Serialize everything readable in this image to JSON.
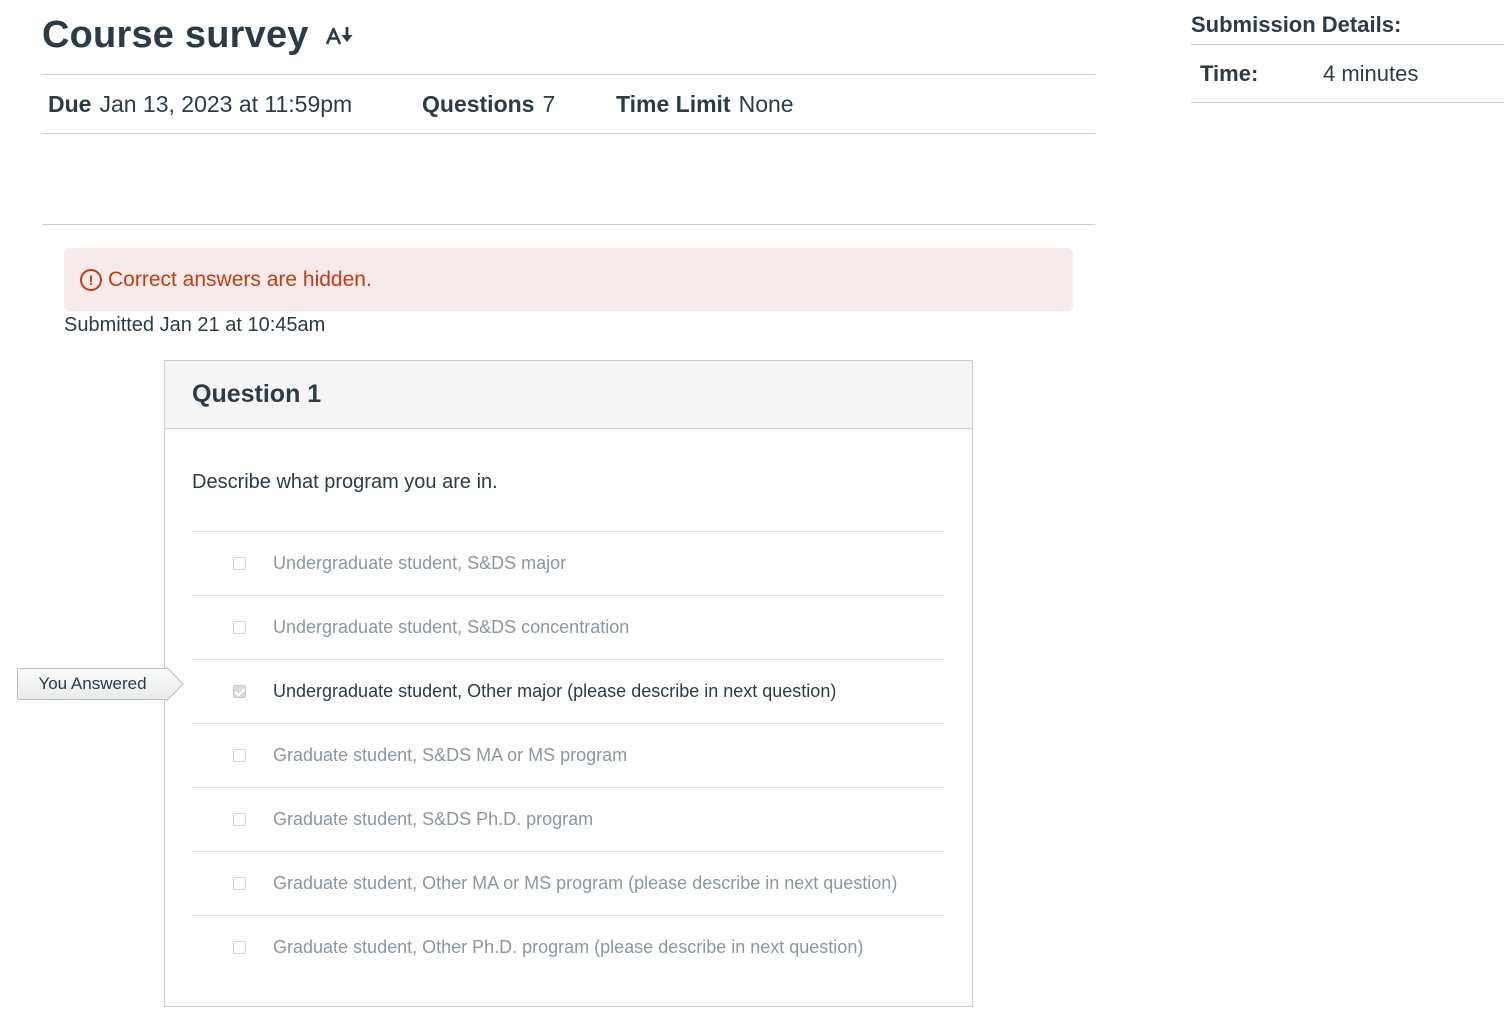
{
  "quiz": {
    "title": "Course survey",
    "title_icon": "sort-down-icon",
    "meta": {
      "due_label": "Due",
      "due_value": "Jan 13, 2023 at 11:59pm",
      "questions_label": "Questions",
      "questions_value": "7",
      "time_limit_label": "Time Limit",
      "time_limit_value": "None"
    }
  },
  "submission_details": {
    "title": "Submission Details:",
    "time_label": "Time:",
    "time_value": "4 minutes"
  },
  "alert": {
    "icon": "exclamation-circle-icon",
    "text": "Correct answers are hidden."
  },
  "submitted_text": "Submitted Jan 21 at 10:45am",
  "question": {
    "header": "Question 1",
    "prompt": "Describe what program you are in.",
    "flag_label": "You Answered",
    "answers": [
      {
        "text": "Undergraduate student, S&DS major",
        "checked": false
      },
      {
        "text": "Undergraduate student, S&DS concentration",
        "checked": false
      },
      {
        "text": "Undergraduate student, Other major (please describe in next question)",
        "checked": true
      },
      {
        "text": "Graduate student, S&DS MA or MS program",
        "checked": false
      },
      {
        "text": "Graduate student, S&DS Ph.D. program",
        "checked": false
      },
      {
        "text": "Graduate student, Other MA or MS program (please describe in next question)",
        "checked": false
      },
      {
        "text": "Graduate student, Other Ph.D. program (please describe in next question)",
        "checked": false
      }
    ]
  },
  "colors": {
    "text": "#2d3b45",
    "muted": "#8b969e",
    "alert_bg": "#f6eaea",
    "alert_text": "#c23c0d",
    "rule": "#c7cdd1"
  }
}
